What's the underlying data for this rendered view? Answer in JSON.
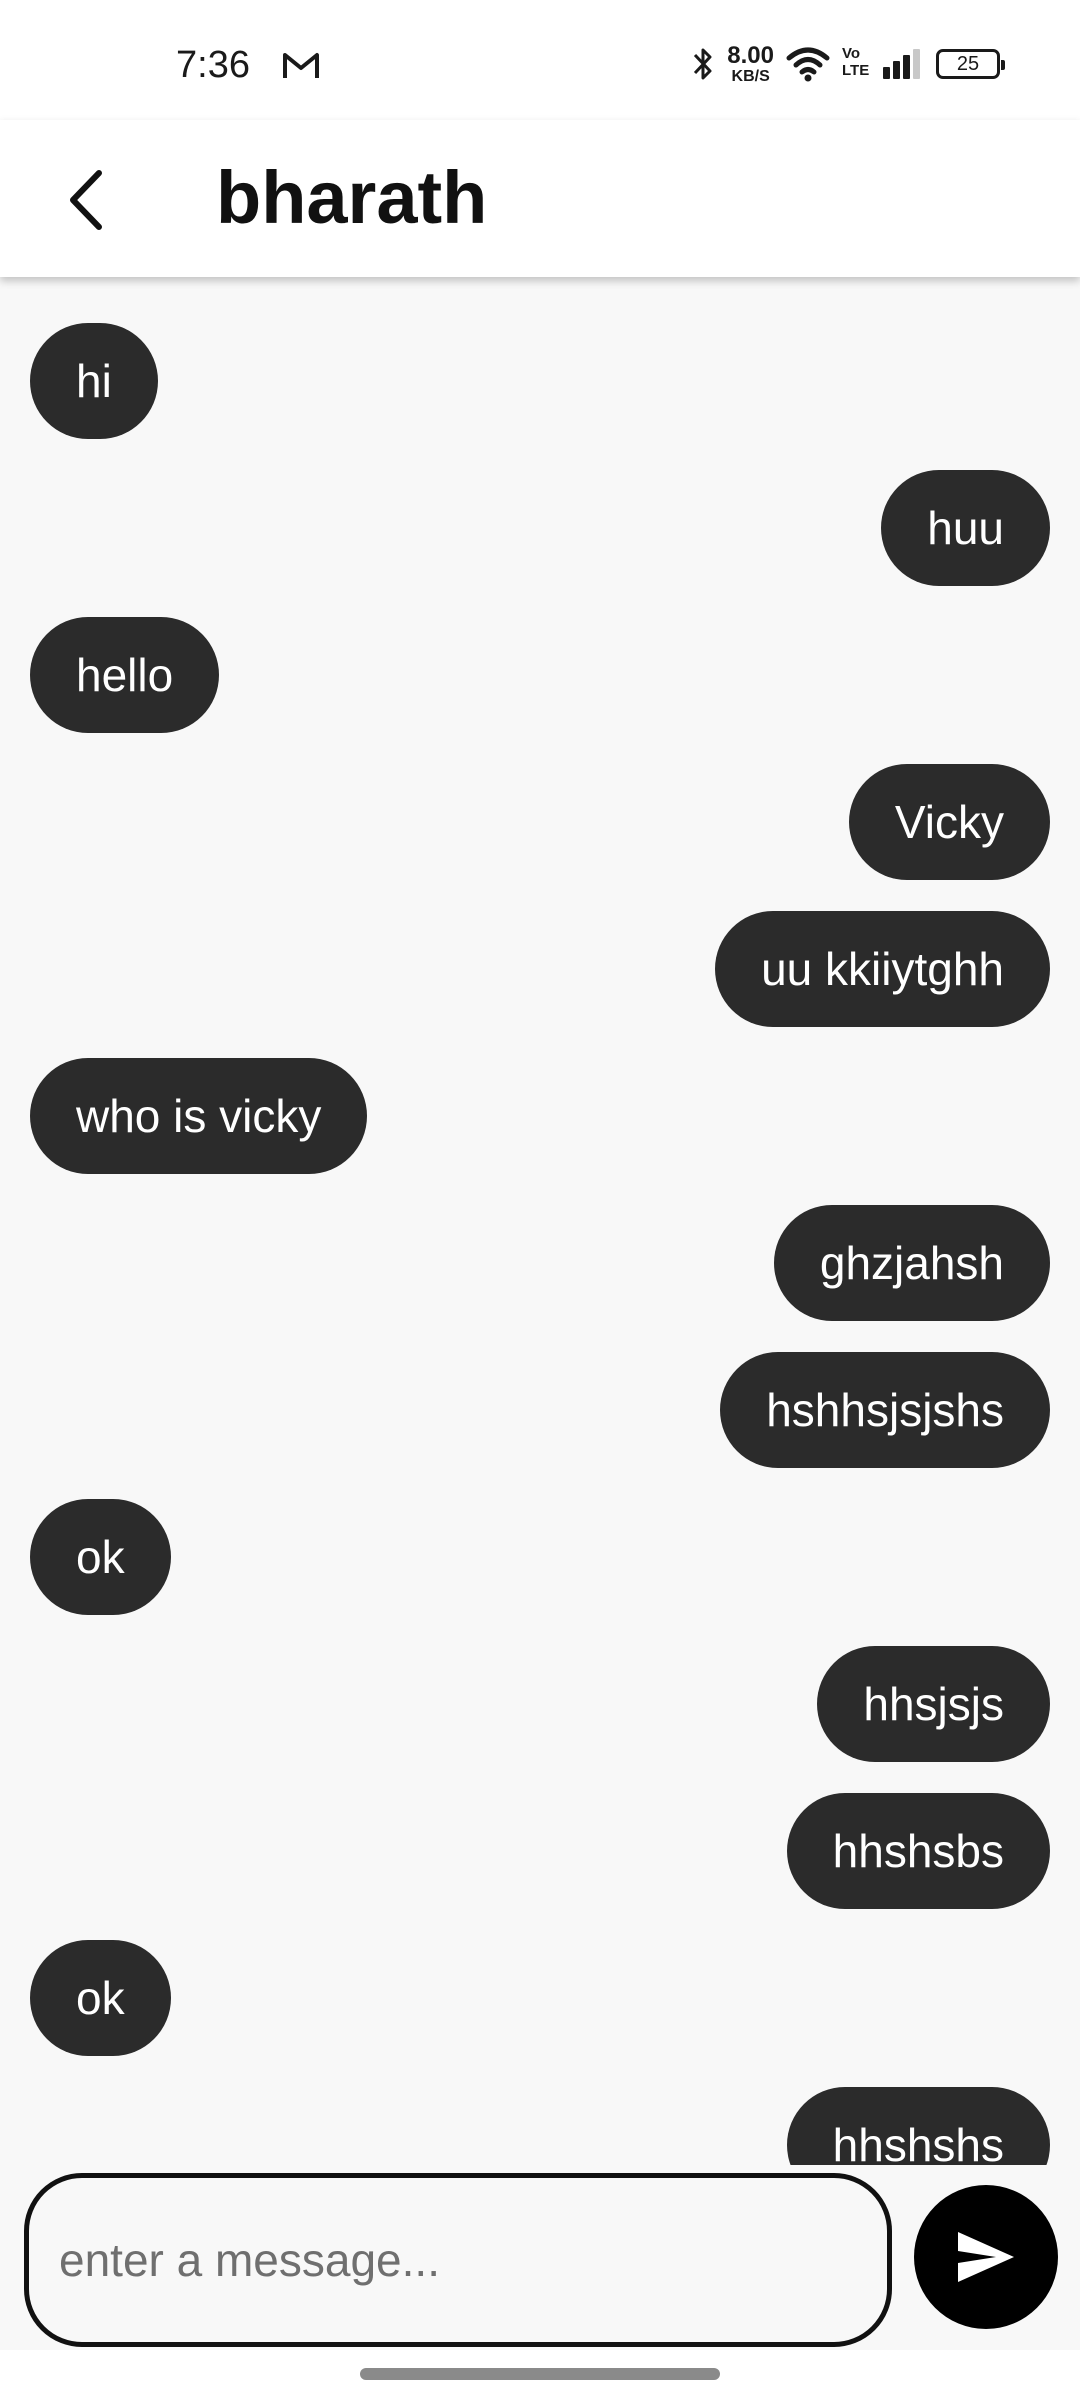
{
  "status_bar": {
    "time": "7:36",
    "net_speed_value": "8.00",
    "net_speed_unit": "KB/S",
    "volte_top": "Vo",
    "volte_bottom": "LTE",
    "battery": "25",
    "icons": [
      "gmail-icon",
      "bluetooth-icon",
      "wifi-icon",
      "volte-icon",
      "signal-icon",
      "battery-icon"
    ]
  },
  "header": {
    "title": "bharath",
    "back_icon": "chevron-left-icon"
  },
  "messages": [
    {
      "text": "hi",
      "side": "received"
    },
    {
      "text": "huu",
      "side": "sent"
    },
    {
      "text": "hello",
      "side": "received"
    },
    {
      "text": "Vicky",
      "side": "sent"
    },
    {
      "text": "uu kkiiytghh",
      "side": "sent"
    },
    {
      "text": "who is vicky",
      "side": "received"
    },
    {
      "text": "ghzjahsh",
      "side": "sent"
    },
    {
      "text": "hshhsjsjshs",
      "side": "sent"
    },
    {
      "text": "ok",
      "side": "received"
    },
    {
      "text": "hhsjsjs",
      "side": "sent"
    },
    {
      "text": "hhshsbs",
      "side": "sent"
    },
    {
      "text": "ok",
      "side": "received"
    },
    {
      "text": "hhshshs",
      "side": "sent"
    }
  ],
  "composer": {
    "placeholder": "enter a message...",
    "value": "",
    "send_icon": "send-icon"
  },
  "colors": {
    "bubble": "#2b2b2b",
    "bubble_text": "#ffffff",
    "background": "#f8f8f8",
    "send_button": "#000000"
  }
}
